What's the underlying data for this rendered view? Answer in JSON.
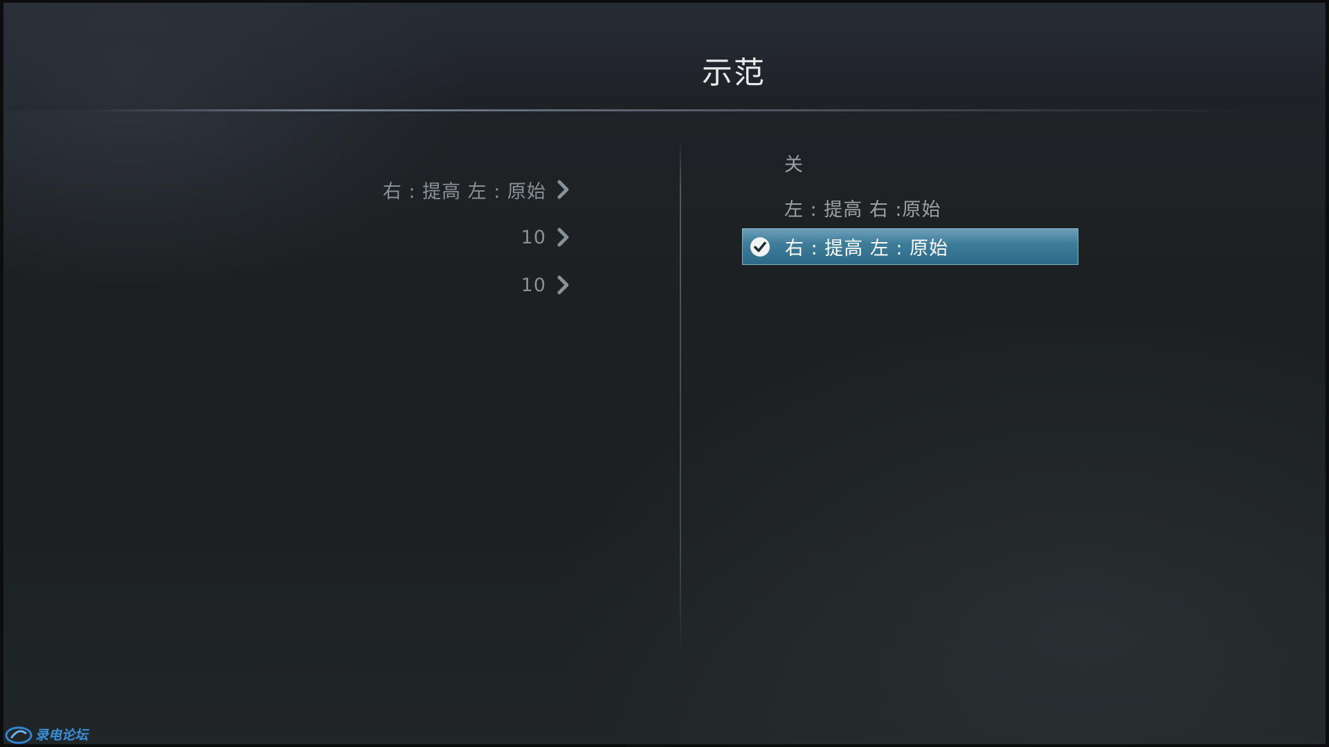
{
  "header": {
    "title": "示范"
  },
  "settings": {
    "rows": [
      {
        "value": "右 : 提高   左 : 原始"
      },
      {
        "value": "10"
      },
      {
        "value": "10"
      }
    ]
  },
  "options": {
    "items": [
      {
        "label": "关",
        "selected": false
      },
      {
        "label": "左 : 提高   右 :原始",
        "selected": false
      },
      {
        "label": "右 : 提高   左 : 原始",
        "selected": true
      }
    ]
  },
  "watermark": {
    "text": "录电论坛"
  },
  "colors": {
    "selection_fill": "#3f7e9b",
    "selection_border": "#86b3c8",
    "text_primary": "#e6e8ea",
    "text_muted": "#8a9196",
    "background": "#1c2022"
  },
  "icons": {
    "chevron": "chevron-right-icon",
    "check": "check-circle-icon",
    "logo": "forum-logo-icon"
  }
}
